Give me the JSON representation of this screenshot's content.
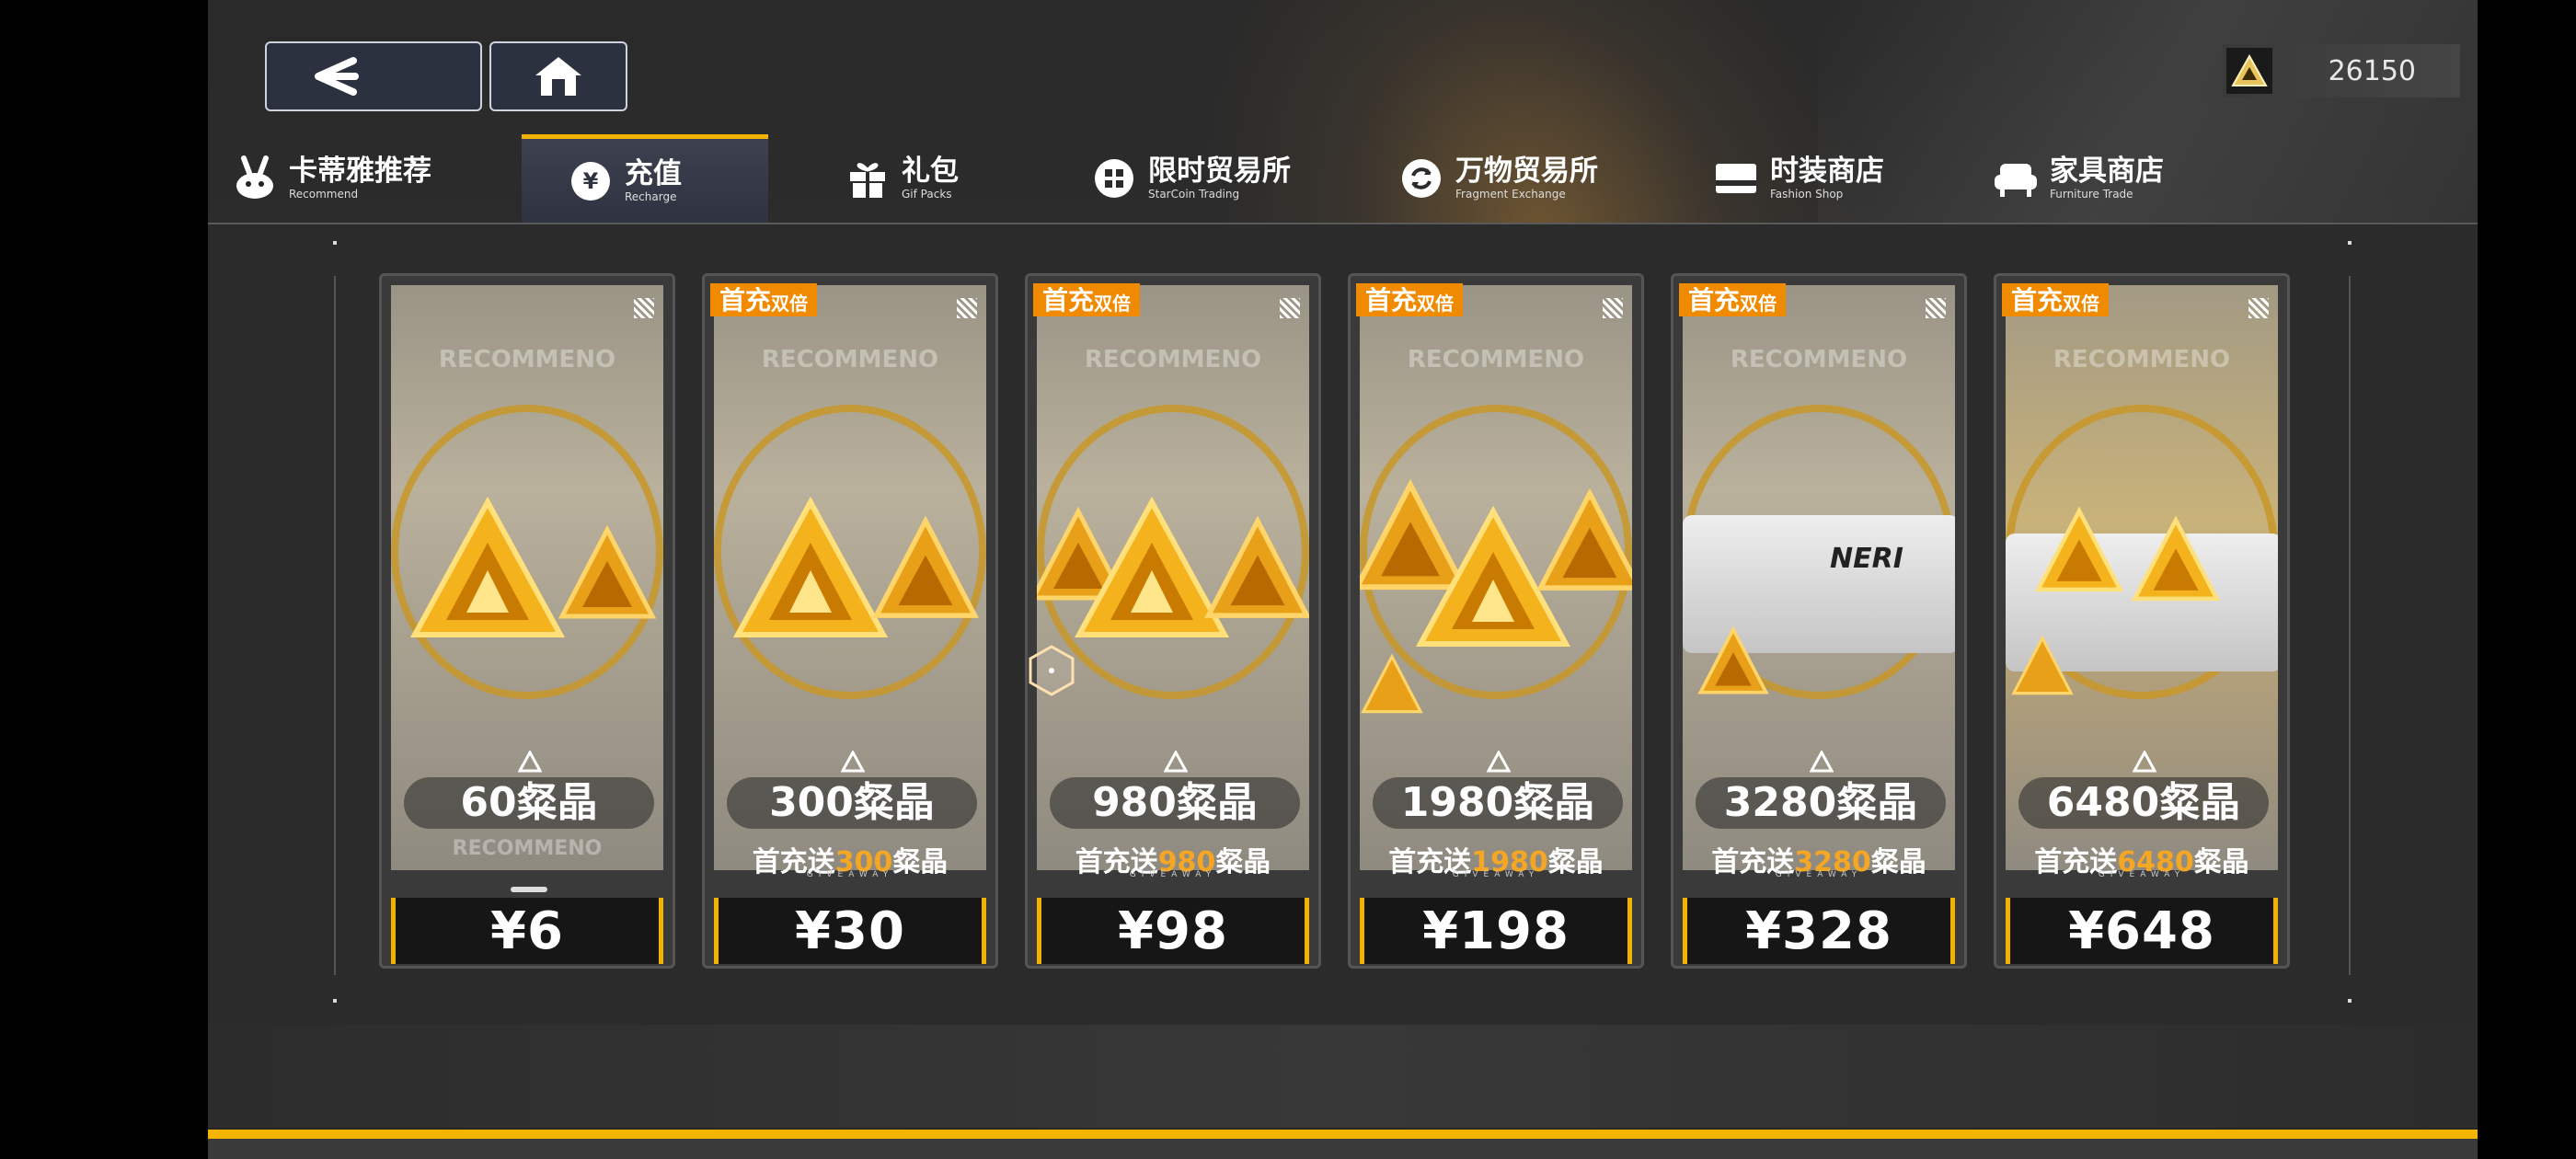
{
  "header": {
    "back_label": "<",
    "currency": {
      "icon": "triangle-crystal-icon",
      "value": "26150"
    }
  },
  "tabs": [
    {
      "name": "卡蒂雅推荐",
      "sub": "Recommend",
      "icon": "rabbit-icon",
      "active": false
    },
    {
      "name": "充值",
      "sub": "Recharge",
      "icon": "yen-icon",
      "active": true
    },
    {
      "name": "礼包",
      "sub": "Gif Packs",
      "icon": "gift-icon",
      "active": false
    },
    {
      "name": "限时贸易所",
      "sub": "StarCoin Trading",
      "icon": "coin-icon",
      "active": false
    },
    {
      "name": "万物贸易所",
      "sub": "Fragment Exchange",
      "icon": "exchange-icon",
      "active": false
    },
    {
      "name": "时装商店",
      "sub": "Fashion Shop",
      "icon": "card-icon",
      "active": false
    },
    {
      "name": "家具商店",
      "sub": "Furniture Trade",
      "icon": "sofa-icon",
      "active": false
    }
  ],
  "cards": [
    {
      "badge_main": "",
      "badge_sub": "",
      "amount": "60粲晶",
      "bonus_prefix": "",
      "bonus_value": "",
      "bonus_suffix": "",
      "footer": "RECOMMENO",
      "price": "¥6",
      "watermark": "RECOMMENO"
    },
    {
      "badge_main": "首充",
      "badge_sub": "双倍",
      "amount": "300粲晶",
      "bonus_prefix": "首充送",
      "bonus_value": "300",
      "bonus_suffix": "粲晶",
      "giveaway": "GIVEAWAY",
      "price": "¥30",
      "watermark": "RECOMMENO"
    },
    {
      "badge_main": "首充",
      "badge_sub": "双倍",
      "amount": "980粲晶",
      "bonus_prefix": "首充送",
      "bonus_value": "980",
      "bonus_suffix": "粲晶",
      "giveaway": "GIVEAWAY",
      "price": "¥98",
      "watermark": "RECOMMENO"
    },
    {
      "badge_main": "首充",
      "badge_sub": "双倍",
      "amount": "1980粲晶",
      "bonus_prefix": "首充送",
      "bonus_value": "1980",
      "bonus_suffix": "粲晶",
      "giveaway": "GIVEAWAY",
      "price": "¥198",
      "watermark": "RECOMMENO"
    },
    {
      "badge_main": "首充",
      "badge_sub": "双倍",
      "amount": "3280粲晶",
      "bonus_prefix": "首充送",
      "bonus_value": "3280",
      "bonus_suffix": "粲晶",
      "giveaway": "GIVEAWAY",
      "price": "¥328",
      "watermark": "RECOMMENO",
      "box_brand": "NERI"
    },
    {
      "badge_main": "首充",
      "badge_sub": "双倍",
      "amount": "6480粲晶",
      "bonus_prefix": "首充送",
      "bonus_value": "6480",
      "bonus_suffix": "粲晶",
      "giveaway": "GIVEAWAY",
      "price": "¥648",
      "watermark": "RECOMMENO"
    }
  ],
  "colors": {
    "accent": "#f2b200",
    "badge": "#f08a00",
    "bonus_highlight": "#f5a623"
  }
}
